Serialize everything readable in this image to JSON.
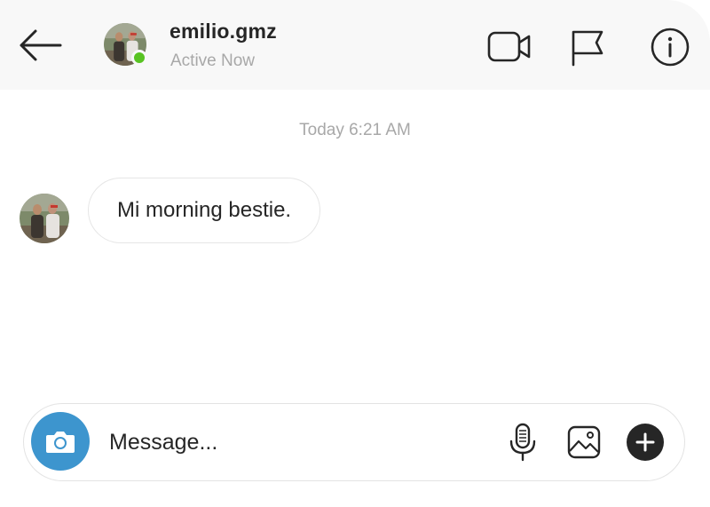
{
  "header": {
    "username": "emilio.gmz",
    "status": "Active Now",
    "icons": {
      "back": "arrow-left-icon",
      "video": "video-camera-icon",
      "flag": "flag-icon",
      "info": "info-icon"
    },
    "online_color": "#58c322"
  },
  "conversation": {
    "timestamp": "Today 6:21 AM",
    "messages": [
      {
        "sender": "emilio.gmz",
        "text": "Mi morning bestie."
      }
    ]
  },
  "composer": {
    "placeholder": "Message...",
    "icons": {
      "camera": "camera-icon",
      "mic": "microphone-icon",
      "gallery": "image-icon",
      "add": "plus-circle-icon"
    },
    "camera_color": "#3d95ce"
  },
  "colors": {
    "header_bg": "#f8f8f8",
    "text_primary": "#262626",
    "text_secondary": "#a8a8a8"
  }
}
